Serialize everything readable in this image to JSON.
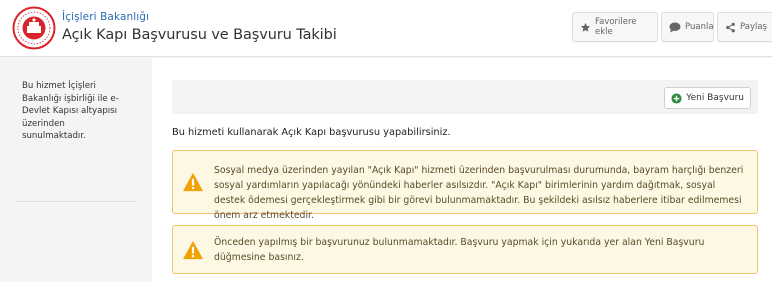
{
  "header": {
    "ministry": "İçişleri Bakanlığı",
    "title": "Açık Kapı Başvurusu ve Başvuru Takibi",
    "buttons": {
      "favorite": "Favorilere ekle",
      "rate": "Puanla",
      "share": "Paylaş"
    }
  },
  "sidebar": {
    "info": "Bu hizmet İçişleri Bakanlığı işbirliği ile e-Devlet Kapısı altyapısı üzerinden sunulmaktadır."
  },
  "main": {
    "new_application": "Yeni Başvuru",
    "intro": "Bu hizmeti kullanarak Açık Kapı başvurusu yapabilirsiniz.",
    "alerts": [
      "Sosyal medya üzerinden yayılan \"Açık Kapı\" hizmeti üzerinden başvurulması durumunda, bayram harçlığı benzeri sosyal yardımların yapılacağı yönündeki haberler asılsızdır. \"Açık Kapı\" birimlerinin yardım dağıtmak, sosyal destek ödemesi gerçekleştirmek gibi bir görevi bulunmamaktadır. Bu şekildeki asılsız haberlere itibar edilmemesi önem arz etmektedir.",
      "Önceden yapılmış bir başvurunuz bulunmamaktadır. Başvuru yapmak için yukarıda yer alan Yeni Başvuru düğmesine basınız."
    ]
  },
  "colors": {
    "accent_blue": "#2b6cb0",
    "logo_red": "#d9242b",
    "success_green": "#2e8b3e",
    "warning_bg": "#fcf8e3",
    "warning_border": "#f0c36d",
    "warning_icon": "#f0a202"
  },
  "icons": {
    "logo": "ministry-emblem-icon",
    "favorite": "star-icon",
    "rate": "speech-bubble-icon",
    "share": "share-icon",
    "new": "plus-circle-icon",
    "alert": "warning-triangle-icon"
  }
}
